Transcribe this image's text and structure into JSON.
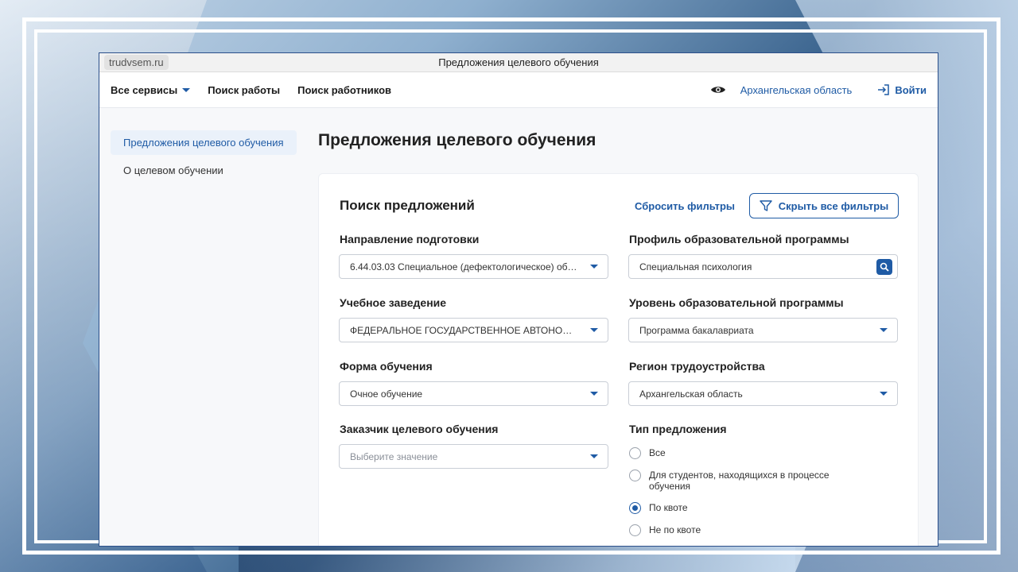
{
  "browser": {
    "url": "trudvsem.ru",
    "window_title": "Предложения целевого обучения"
  },
  "nav": {
    "items": [
      "Все сервисы",
      "Поиск работы",
      "Поиск работников"
    ],
    "region": "Архангельская область",
    "login": "Войти"
  },
  "sidebar": {
    "items": [
      {
        "label": "Предложения целевого обучения",
        "active": true
      },
      {
        "label": "О целевом обучении",
        "active": false
      }
    ]
  },
  "page": {
    "title": "Предложения целевого обучения"
  },
  "filters": {
    "title": "Поиск предложений",
    "reset_label": "Сбросить фильтры",
    "hide_label": "Скрыть все фильтры",
    "direction": {
      "label": "Направление подготовки",
      "value": "6.44.03.03 Специальное (дефектологическое) образование"
    },
    "profile": {
      "label": "Профиль образовательной программы",
      "value": "Специальная психология"
    },
    "institution": {
      "label": "Учебное заведение",
      "value": "ФЕДЕРАЛЬНОЕ ГОСУДАРСТВЕННОЕ АВТОНОМНОЕ"
    },
    "level": {
      "label": "Уровень образовательной программы",
      "value": "Программа бакалавриата"
    },
    "form": {
      "label": "Форма обучения",
      "value": "Очное обучение"
    },
    "region": {
      "label": "Регион трудоустройства",
      "value": "Архангельская область"
    },
    "customer": {
      "label": "Заказчик целевого обучения",
      "placeholder": "Выберите значение"
    },
    "offer_type": {
      "label": "Тип предложения",
      "options": [
        {
          "label": "Все",
          "checked": false
        },
        {
          "label": "Для студентов, находящихся в процессе обучения",
          "checked": false
        },
        {
          "label": "По квоте",
          "checked": true
        },
        {
          "label": "Не по квоте",
          "checked": false
        }
      ]
    }
  },
  "colors": {
    "accent": "#1f5ba5",
    "frame": "#ffffff"
  }
}
